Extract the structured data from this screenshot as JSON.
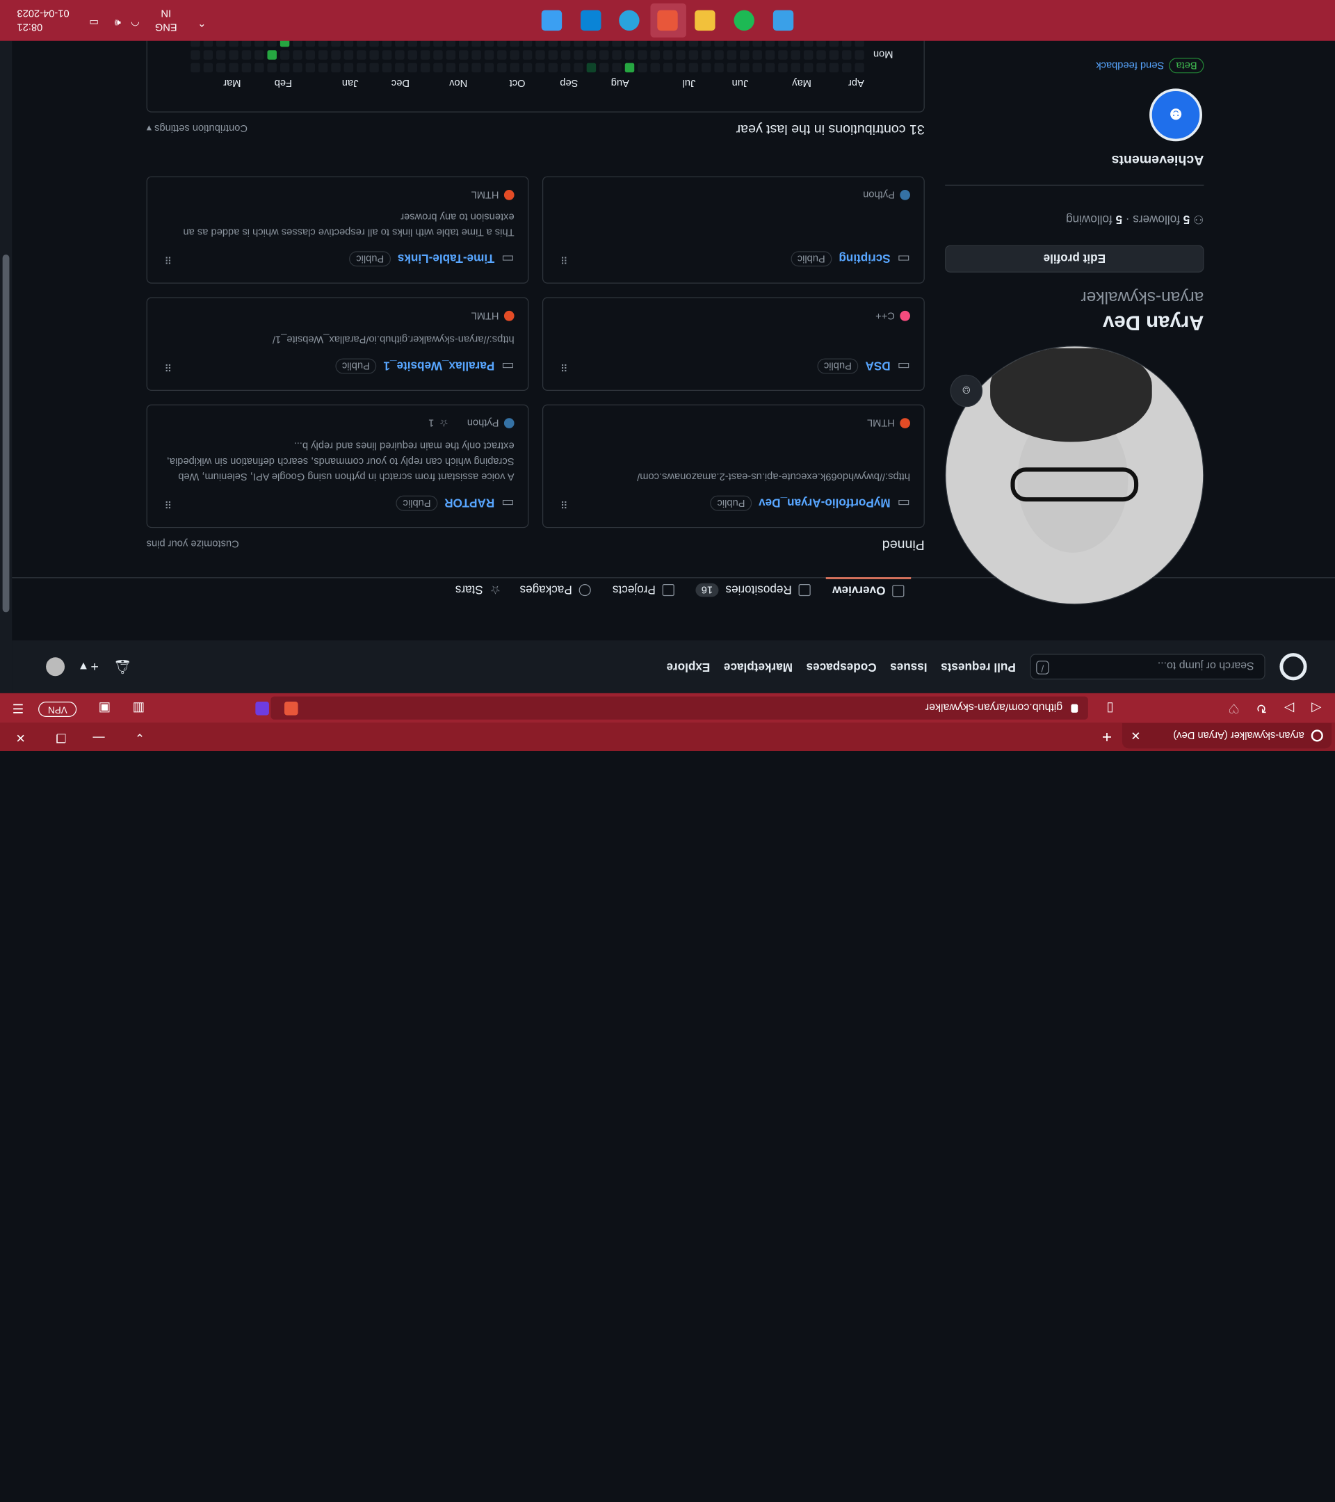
{
  "browser": {
    "tab_title": "aryan-skywalker (Aryan Dev)",
    "url": "github.com/aryan-skywalker",
    "vpn_label": "VPN"
  },
  "github_header": {
    "search_placeholder": "Search or jump to...",
    "search_shortcut": "/",
    "nav": [
      "Pull requests",
      "Issues",
      "Codespaces",
      "Marketplace",
      "Explore"
    ]
  },
  "profile": {
    "full_name": "Aryan Dev",
    "username": "aryan-skywalker",
    "edit_profile_label": "Edit profile",
    "followers_count": "5",
    "followers_label": "followers",
    "following_count": "5",
    "following_label": "following",
    "achievements_title": "Achievements",
    "beta_label": "Beta",
    "feedback_label": "Send feedback"
  },
  "tabs": [
    {
      "label": "Overview",
      "icon": "book-icon"
    },
    {
      "label": "Repositories",
      "count": "16",
      "icon": "repo-icon"
    },
    {
      "label": "Projects",
      "icon": "table-icon"
    },
    {
      "label": "Packages",
      "icon": "package-icon"
    },
    {
      "label": "Stars",
      "icon": "star-icon"
    }
  ],
  "pinned": {
    "title": "Pinned",
    "customize_label": "Customize your pins",
    "repos": [
      {
        "name": "MyPortfolio-Aryan_Dev",
        "visibility": "Public",
        "description": "https://bwywhdo69k.execute-api.us-east-2.amazonaws.com/",
        "language": "HTML",
        "lang_color": "#e34c26"
      },
      {
        "name": "RAPTOR",
        "visibility": "Public",
        "description": "A voice assistant from scratch in python using Google API, Selenium, Web Scraping which can reply to your commands, search defination sin wikipedia, extract only the main required lines and reply b...",
        "language": "Python",
        "lang_color": "#3572A5",
        "stars": "1"
      },
      {
        "name": "DSA",
        "visibility": "Public",
        "description": "",
        "language": "C++",
        "lang_color": "#f34b7d"
      },
      {
        "name": "Parallax_Website_1",
        "visibility": "Public",
        "description": "https://aryan-skywalker.github.io/Parallax_Website_1/",
        "language": "HTML",
        "lang_color": "#e34c26"
      },
      {
        "name": "Scripting",
        "visibility": "Public",
        "description": "",
        "language": "Python",
        "lang_color": "#3572A5"
      },
      {
        "name": "Time-Table-Links",
        "visibility": "Public",
        "description": "This a Time table with links to all respective classes which is added as an extension to any browser",
        "language": "HTML",
        "lang_color": "#e34c26"
      }
    ]
  },
  "contributions": {
    "title": "31 contributions in the last year",
    "settings_label": "Contribution settings",
    "months": [
      "Apr",
      "May",
      "Jun",
      "Jul",
      "Aug",
      "Sep",
      "Oct",
      "Nov",
      "Dec",
      "Jan",
      "Feb",
      "Mar"
    ],
    "day_label": "Mon"
  },
  "taskbar": {
    "lang_line1": "ENG",
    "lang_line2": "IN",
    "time": "08:21",
    "date": "01-04-2023"
  }
}
